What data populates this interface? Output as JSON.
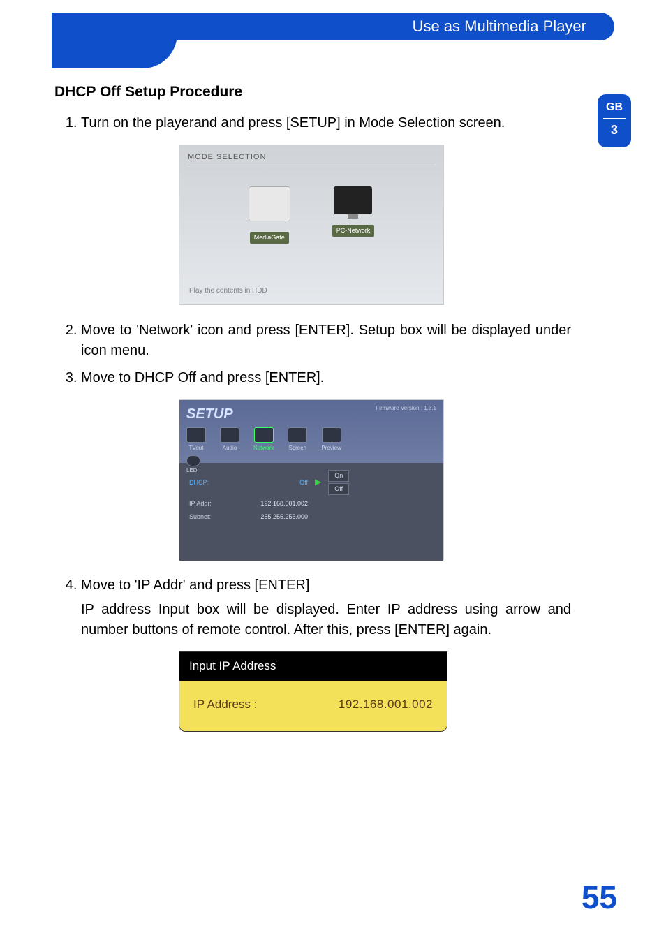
{
  "header": {
    "title": "Use as Multimedia Player"
  },
  "side_tab": {
    "lang": "GB",
    "chapter": "3"
  },
  "section_title": "DHCP Off Setup Procedure",
  "steps": [
    {
      "text": "Turn on the playerand and press [SETUP] in Mode Selection screen."
    },
    {
      "text": "Move to 'Network' icon and press [ENTER]. Setup box will be displayed under icon menu."
    },
    {
      "text": "Move to DHCP Off and press [ENTER]."
    },
    {
      "text": "Move to 'IP Addr' and press [ENTER]",
      "extra": "IP address Input box will be displayed. Enter IP address using arrow and number buttons of remote control. After this, press [ENTER] again."
    }
  ],
  "fig1": {
    "title": "MODE SELECTION",
    "icons": [
      {
        "label": "MediaGate"
      },
      {
        "label": "PC-Network"
      }
    ],
    "footer": "Play the contents in HDD"
  },
  "fig2": {
    "title": "SETUP",
    "firmware": "Firmware Version : 1.3.1",
    "tabs": [
      "TVout",
      "Audio",
      "Network",
      "Screen",
      "Preview"
    ],
    "led_label": "LED",
    "rows": {
      "dhcp_label": "DHCP:",
      "dhcp_val": "Off",
      "ip_label": "IP Addr:",
      "ip_val": "192.168.001.002",
      "subnet_label": "Subnet:",
      "subnet_val": "255.255.255.000"
    },
    "options": {
      "on": "On",
      "off": "Off"
    }
  },
  "fig3": {
    "head": "Input IP Address",
    "label": "IP Address :",
    "value": "192.168.001.002"
  },
  "page_number": "55"
}
